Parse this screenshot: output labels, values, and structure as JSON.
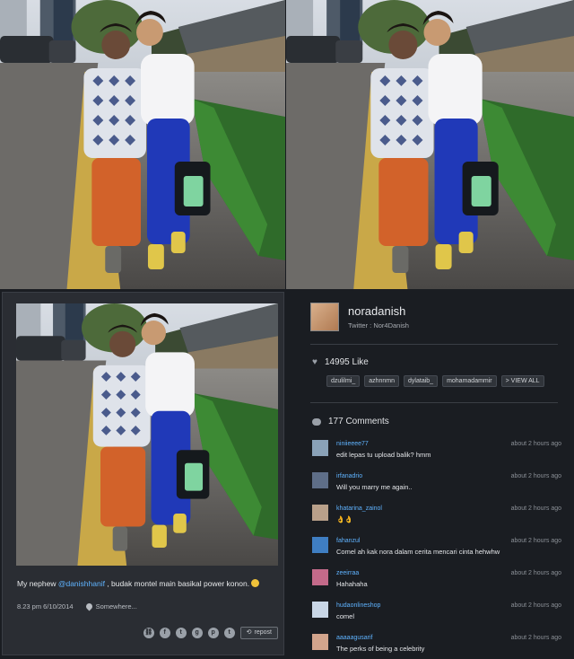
{
  "post": {
    "caption_pre": "My nephew ",
    "caption_mention": "@danishhanif",
    "caption_post": " , budak montel main basikal power konon.",
    "date": "8.23 pm 6/10/2014",
    "location": "Somewhere...",
    "repost_label": "repost"
  },
  "share_icons": [
    "link-icon",
    "facebook-icon",
    "twitter-icon",
    "google-plus-icon",
    "pinterest-icon",
    "tumblr-icon"
  ],
  "share_glyphs": [
    "⛓",
    "f",
    "t",
    "g",
    "p",
    "t"
  ],
  "profile": {
    "username": "noradanish",
    "twitter": "Twitter : Nor4Danish"
  },
  "likes": {
    "count_label": "14995 Like",
    "users": [
      "dzulilmi_",
      "azhnnmn",
      "dylataib_",
      "mohamadammir",
      "> VIEW ALL"
    ]
  },
  "comments_header": "177 Comments",
  "comments": [
    {
      "user": "niniieeee77",
      "text": "edit lepas tu upload balik? hmm",
      "time": "about 2 hours ago",
      "color": "#8aa2b8"
    },
    {
      "user": "irfanadrio",
      "text": "Will you marry me again..",
      "time": "about 2 hours ago",
      "color": "#5e6e88"
    },
    {
      "user": "khatarina_zainol",
      "text": "👌👌",
      "time": "about 2 hours ago",
      "color": "#b9a08a"
    },
    {
      "user": "fahanzul",
      "text": "Comel ah kak nora dalam cerita mencari cinta hehwhw",
      "time": "about 2 hours ago",
      "color": "#3f7ec2"
    },
    {
      "user": "zeeirraa",
      "text": "Hahahaha",
      "time": "about 2 hours ago",
      "color": "#c46a8a"
    },
    {
      "user": "hudaonlineshop",
      "text": "comel",
      "time": "about 2 hours ago",
      "color": "#c9d6e6"
    },
    {
      "user": "aaaaagusarif",
      "text": "The perks of being a celebrity",
      "time": "about 2 hours ago",
      "color": "#d2a48c"
    }
  ]
}
